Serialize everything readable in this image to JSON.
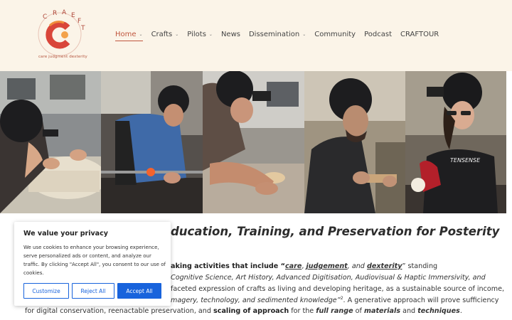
{
  "brand": {
    "letters": [
      "C",
      "R",
      "A",
      "E",
      "F",
      "T"
    ],
    "tagline": "care judgment dexterity"
  },
  "nav": [
    {
      "label": "Home",
      "dropdown": true,
      "active": true
    },
    {
      "label": "Crafts",
      "dropdown": true
    },
    {
      "label": "Pilots",
      "dropdown": true
    },
    {
      "label": "News",
      "dropdown": false
    },
    {
      "label": "Dissemination",
      "dropdown": true
    },
    {
      "label": "Community",
      "dropdown": false
    },
    {
      "label": "Podcast",
      "dropdown": false
    },
    {
      "label": "CRAFTOUR",
      "dropdown": false
    }
  ],
  "hero": {
    "panels": [
      "stone-sculpting",
      "glass-blowing",
      "clay-throwing",
      "wood-carving",
      "jewellery-making"
    ],
    "shirt_print": "TENSENSE"
  },
  "main": {
    "title": "ducation, Training, and Preservation for Posterity",
    "line1": {
      "prefix": "aking activities that include “",
      "care": "care",
      "sep1": ", ",
      "judgement": "judgement",
      "sep2": ", and ",
      "dexterity": "dexterity",
      "suffix": "” standing"
    },
    "line2": "Cognitive Science, Art History, Advanced Digitisation, Audiovisual & Haptic Immersivity, and",
    "line3": "faceted expression of crafts as living and developing heritage, as a sustainable source of income,",
    "line4": {
      "italic": "magery, technology, and sedimented knowledge”",
      "sup": "2",
      "rest": ". A generative approach will prove sufficiency"
    },
    "line5": {
      "t1": "for digital conservation, reenactable preservation, and ",
      "b1": "scaling of approach",
      "t2": " for the ",
      "b2": "full range",
      "t3": " of ",
      "b3": "materials",
      "t4": " and ",
      "b4": "techniques",
      "t5": "."
    }
  },
  "cookie": {
    "title": "We value your privacy",
    "text": "We use cookies to enhance your browsing experience, serve personalized ads or content, and analyze our traffic. By clicking \"Accept All\", you consent to our use of cookies.",
    "customize": "Customize",
    "reject": "Reject All",
    "accept": "Accept All"
  },
  "colors": {
    "header_bg": "#fbf4e8",
    "accent": "#c0563e",
    "button_blue": "#1863dc"
  }
}
